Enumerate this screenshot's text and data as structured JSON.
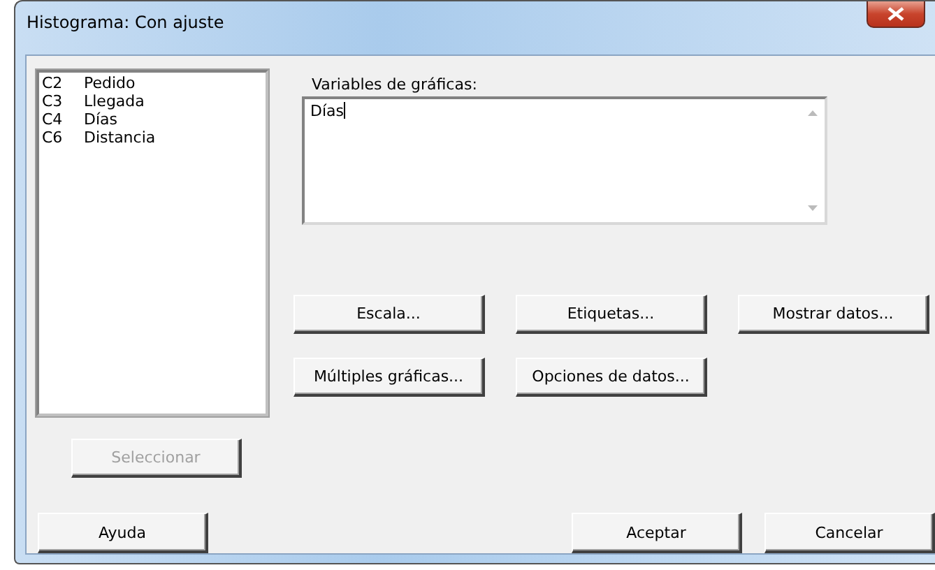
{
  "window": {
    "title": "Histograma: Con ajuste"
  },
  "columns_list": [
    {
      "id": "C2",
      "name": "Pedido"
    },
    {
      "id": "C3",
      "name": "Llegada"
    },
    {
      "id": "C4",
      "name": "Días"
    },
    {
      "id": "C6",
      "name": "Distancia"
    }
  ],
  "variables_field": {
    "label": "Variables de gráficas:",
    "value": "Días"
  },
  "option_buttons": [
    [
      "Escala...",
      "Etiquetas...",
      "Mostrar datos..."
    ],
    [
      "Múltiples gráficas...",
      "Opciones de datos..."
    ]
  ],
  "select_button": {
    "label": "Seleccionar",
    "disabled": true
  },
  "buttons": {
    "help": "Ayuda",
    "ok": "Aceptar",
    "cancel": "Cancelar"
  }
}
